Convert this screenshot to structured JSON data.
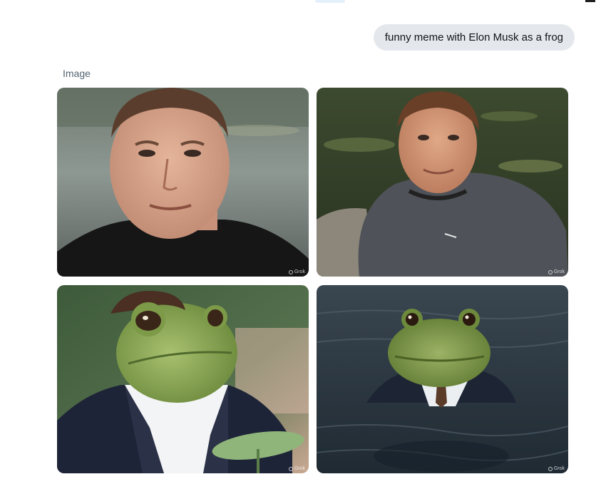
{
  "chat": {
    "user_message": "funny meme with Elon Musk as a frog",
    "result_label": "Image"
  },
  "images": [
    {
      "subject": "man-portrait-lake",
      "watermark": "Grok"
    },
    {
      "subject": "man-sitting-by-pond",
      "watermark": "Grok"
    },
    {
      "subject": "frog-in-suit-lily-pad",
      "watermark": "Grok"
    },
    {
      "subject": "frog-in-suit-in-water",
      "watermark": "Grok"
    }
  ],
  "colors": {
    "bubble_bg": "#e4e8ec",
    "label_text": "#536471",
    "message_text": "#0f1419"
  }
}
